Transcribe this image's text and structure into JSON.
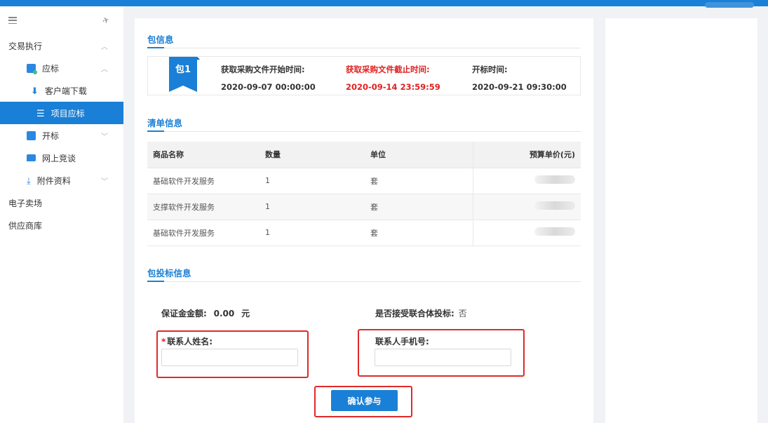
{
  "sidebar": {
    "items": [
      {
        "label": "交易执行"
      },
      {
        "label": "应标"
      },
      {
        "label": "客户端下载"
      },
      {
        "label": "项目应标"
      },
      {
        "label": "开标"
      },
      {
        "label": "网上竞谈"
      },
      {
        "label": "附件资料"
      },
      {
        "label": "电子卖场"
      },
      {
        "label": "供应商库"
      }
    ]
  },
  "package_info": {
    "title": "包信息",
    "badge": "包1",
    "start_label": "获取采购文件开始时间:",
    "start_value": "2020-09-07 00:00:00",
    "end_label": "获取采购文件截止时间:",
    "end_value": "2020-09-14 23:59:59",
    "open_label": "开标时间:",
    "open_value": "2020-09-21 09:30:00",
    "accent_color": "#1a7fd6",
    "deadline_color": "#e02020"
  },
  "list_info": {
    "title": "清单信息",
    "columns": [
      "商品名称",
      "数量",
      "单位",
      "预算单价(元)"
    ],
    "rows": [
      [
        "基础软件开发服务",
        "1",
        "套"
      ],
      [
        "支撑软件开发服务",
        "1",
        "套"
      ],
      [
        "基础软件开发服务",
        "1",
        "套"
      ]
    ]
  },
  "bid_info": {
    "title": "包投标信息",
    "deposit_label": "保证金金额:",
    "deposit_value": "0.00",
    "deposit_unit": "元",
    "consortium_label": "是否接受联合体投标:",
    "consortium_value": "否",
    "contact_name_label": "联系人姓名:",
    "contact_phone_label": "联系人手机号:",
    "contact_name_value": "",
    "contact_phone_value": "",
    "confirm_label": "确认参与"
  }
}
